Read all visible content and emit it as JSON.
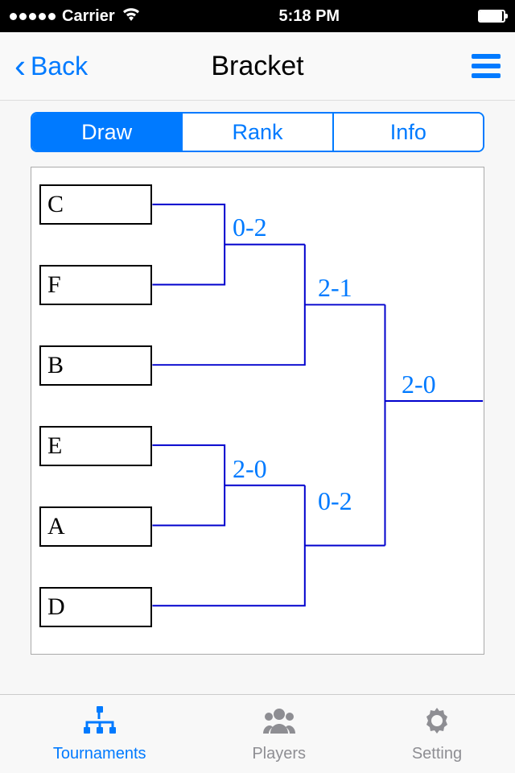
{
  "status": {
    "carrier": "Carrier",
    "time": "5:18 PM"
  },
  "nav": {
    "back_label": "Back",
    "title": "Bracket"
  },
  "segments": {
    "draw": "Draw",
    "rank": "Rank",
    "info": "Info"
  },
  "bracket": {
    "players": {
      "p1": "C",
      "p2": "F",
      "p3": "B",
      "p4": "E",
      "p5": "A",
      "p6": "D"
    },
    "scores": {
      "m1": "0-2",
      "m2": "2-0",
      "s1": "2-1",
      "s2": "0-2",
      "final": "2-0"
    }
  },
  "tabs": {
    "tournaments": "Tournaments",
    "players": "Players",
    "setting": "Setting"
  }
}
